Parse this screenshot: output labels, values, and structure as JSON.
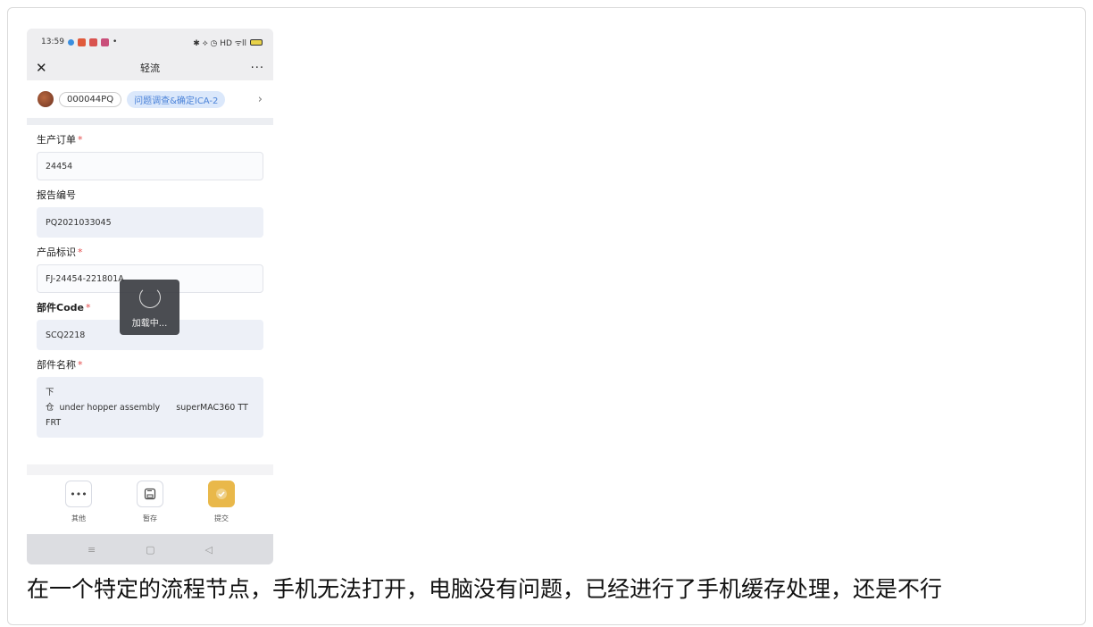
{
  "status_bar": {
    "time": "13:59",
    "right_icons": "✱ ⟡ ◷ HD ᯤll"
  },
  "navbar": {
    "close": "✕",
    "title": "轻流",
    "more": "···"
  },
  "flow": {
    "code": "000044PQ",
    "node": "问题调查&确定ICA-2",
    "chevron": "›"
  },
  "form": {
    "fields": [
      {
        "label": "生产订单",
        "required": true,
        "value": "24454"
      },
      {
        "label": "报告编号",
        "required": false,
        "value": "PQ2021033045"
      },
      {
        "label": "产品标识",
        "required": true,
        "value": "FJ-24454-221801A"
      },
      {
        "label": "部件Code",
        "required": true,
        "value": "SCQ2218"
      },
      {
        "label": "部件名称",
        "required": true,
        "value_line1": "下",
        "value_line2": "仓  under hopper assembly      superMAC360 TT",
        "value_line3": "FRT"
      }
    ],
    "required_mark": "*"
  },
  "loading": {
    "text": "加载中..."
  },
  "actions": [
    {
      "label": "其他",
      "icon": "more-icon"
    },
    {
      "label": "暂存",
      "icon": "save-icon"
    },
    {
      "label": "提交",
      "icon": "submit-check-icon"
    }
  ],
  "system_nav": {
    "menu": "≡",
    "home": "▢",
    "back": "◁"
  },
  "caption": "在一个特定的流程节点，手机无法打开，电脑没有问题，已经进行了手机缓存处理，还是不行",
  "colors": {
    "accent_submit": "#e9b84a",
    "required": "#e34b4b",
    "node_chip": "#4a82d8"
  }
}
